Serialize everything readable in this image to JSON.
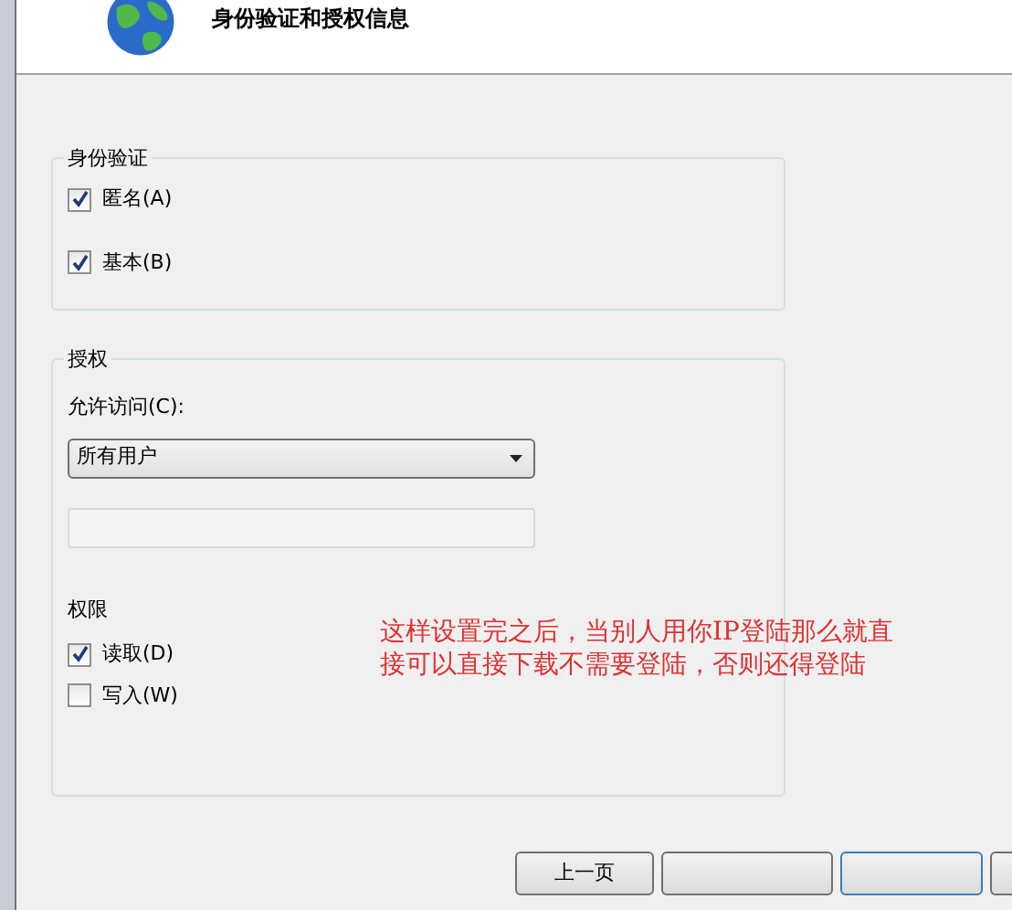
{
  "header": {
    "title": "身份验证和授权信息"
  },
  "authentication": {
    "legend": "身份验证",
    "options": [
      {
        "label": "匿名(A)",
        "checked": true
      },
      {
        "label": "基本(B)",
        "checked": true
      }
    ]
  },
  "authorization": {
    "legend": "授权",
    "access_label": "允许访问(C):",
    "access_value": "所有用户",
    "permissions_label": "权限",
    "permissions": [
      {
        "label": "读取(D)",
        "checked": true
      },
      {
        "label": "写入(W)",
        "checked": false
      }
    ]
  },
  "annotation": "这样设置完之后，当别人用你IP登陆那么就直接可以直接下载不需要登陆，否则还得登陆",
  "buttons": [
    {
      "label": "上一页",
      "primary": false
    },
    {
      "primary": false
    },
    {
      "primary": true
    },
    {
      "primary": false
    }
  ]
}
